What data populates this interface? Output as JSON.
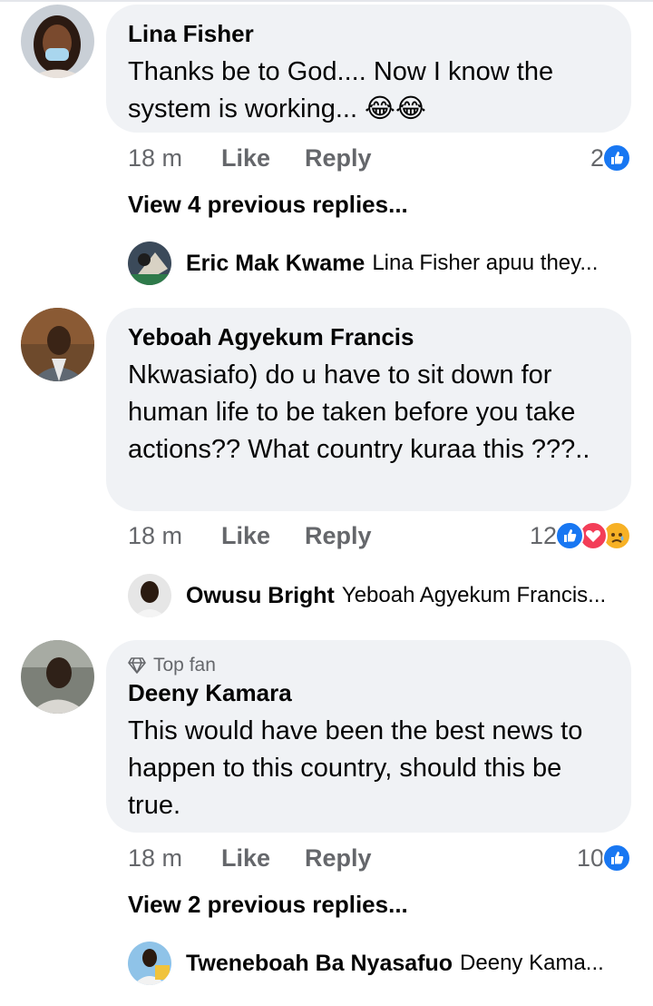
{
  "comments": [
    {
      "author": "Lina Fisher",
      "text": "Thanks be to  God.... Now I know the system is working... 😂😂",
      "time": "18 m",
      "like_label": "Like",
      "reply_label": "Reply",
      "reaction_count": "2",
      "reactions": [
        "like-icon"
      ],
      "view_previous": "View 4 previous replies...",
      "latest_reply": {
        "author": "Eric Mak Kwame",
        "preview": "Lina Fisher apuu they..."
      }
    },
    {
      "author": "Yeboah Agyekum Francis",
      "text": "Nkwasiafo) do u have to sit down for human life to be taken before you take actions?? What country kuraa this ???..",
      "time": "18 m",
      "like_label": "Like",
      "reply_label": "Reply",
      "reaction_count": "12",
      "reactions": [
        "like-icon",
        "love-icon",
        "sad-icon"
      ],
      "latest_reply": {
        "author": "Owusu Bright",
        "preview": "Yeboah Agyekum Francis..."
      }
    },
    {
      "badge": "Top fan",
      "author": "Deeny Kamara",
      "text": "This would have been the best news to happen to this country, should this be true.",
      "time": "18 m",
      "like_label": "Like",
      "reply_label": "Reply",
      "reaction_count": "10",
      "reactions": [
        "like-icon"
      ],
      "view_previous": "View 2 previous replies...",
      "latest_reply": {
        "author": "Tweneboah Ba Nyasafuo",
        "preview": "Deeny Kama..."
      }
    }
  ],
  "colors": {
    "bubble": "#f0f2f5",
    "secondary_text": "#65676b",
    "like_blue": "#1877f2",
    "love_red": "#f33e58",
    "sad_yellow": "#f7b125"
  }
}
